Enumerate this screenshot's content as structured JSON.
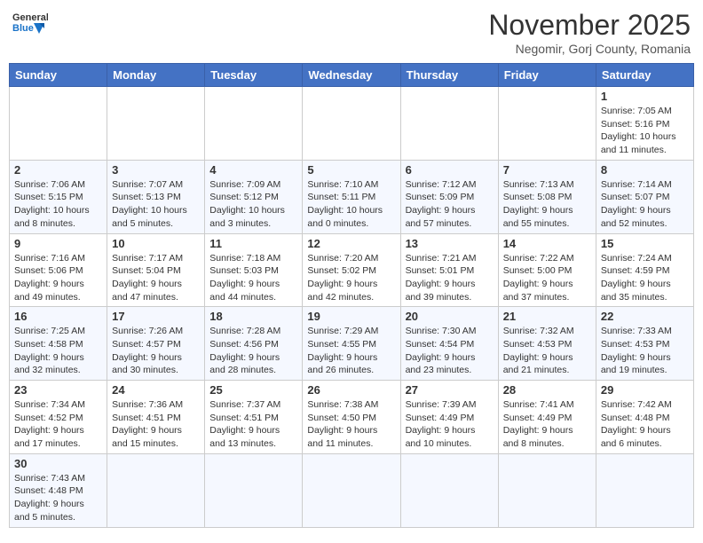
{
  "header": {
    "logo_general": "General",
    "logo_blue": "Blue",
    "month_title": "November 2025",
    "subtitle": "Negomir, Gorj County, Romania"
  },
  "days_of_week": [
    "Sunday",
    "Monday",
    "Tuesday",
    "Wednesday",
    "Thursday",
    "Friday",
    "Saturday"
  ],
  "weeks": [
    [
      {
        "day": "",
        "info": ""
      },
      {
        "day": "",
        "info": ""
      },
      {
        "day": "",
        "info": ""
      },
      {
        "day": "",
        "info": ""
      },
      {
        "day": "",
        "info": ""
      },
      {
        "day": "",
        "info": ""
      },
      {
        "day": "1",
        "info": "Sunrise: 7:05 AM\nSunset: 5:16 PM\nDaylight: 10 hours and 11 minutes."
      }
    ],
    [
      {
        "day": "2",
        "info": "Sunrise: 7:06 AM\nSunset: 5:15 PM\nDaylight: 10 hours and 8 minutes."
      },
      {
        "day": "3",
        "info": "Sunrise: 7:07 AM\nSunset: 5:13 PM\nDaylight: 10 hours and 5 minutes."
      },
      {
        "day": "4",
        "info": "Sunrise: 7:09 AM\nSunset: 5:12 PM\nDaylight: 10 hours and 3 minutes."
      },
      {
        "day": "5",
        "info": "Sunrise: 7:10 AM\nSunset: 5:11 PM\nDaylight: 10 hours and 0 minutes."
      },
      {
        "day": "6",
        "info": "Sunrise: 7:12 AM\nSunset: 5:09 PM\nDaylight: 9 hours and 57 minutes."
      },
      {
        "day": "7",
        "info": "Sunrise: 7:13 AM\nSunset: 5:08 PM\nDaylight: 9 hours and 55 minutes."
      },
      {
        "day": "8",
        "info": "Sunrise: 7:14 AM\nSunset: 5:07 PM\nDaylight: 9 hours and 52 minutes."
      }
    ],
    [
      {
        "day": "9",
        "info": "Sunrise: 7:16 AM\nSunset: 5:06 PM\nDaylight: 9 hours and 49 minutes."
      },
      {
        "day": "10",
        "info": "Sunrise: 7:17 AM\nSunset: 5:04 PM\nDaylight: 9 hours and 47 minutes."
      },
      {
        "day": "11",
        "info": "Sunrise: 7:18 AM\nSunset: 5:03 PM\nDaylight: 9 hours and 44 minutes."
      },
      {
        "day": "12",
        "info": "Sunrise: 7:20 AM\nSunset: 5:02 PM\nDaylight: 9 hours and 42 minutes."
      },
      {
        "day": "13",
        "info": "Sunrise: 7:21 AM\nSunset: 5:01 PM\nDaylight: 9 hours and 39 minutes."
      },
      {
        "day": "14",
        "info": "Sunrise: 7:22 AM\nSunset: 5:00 PM\nDaylight: 9 hours and 37 minutes."
      },
      {
        "day": "15",
        "info": "Sunrise: 7:24 AM\nSunset: 4:59 PM\nDaylight: 9 hours and 35 minutes."
      }
    ],
    [
      {
        "day": "16",
        "info": "Sunrise: 7:25 AM\nSunset: 4:58 PM\nDaylight: 9 hours and 32 minutes."
      },
      {
        "day": "17",
        "info": "Sunrise: 7:26 AM\nSunset: 4:57 PM\nDaylight: 9 hours and 30 minutes."
      },
      {
        "day": "18",
        "info": "Sunrise: 7:28 AM\nSunset: 4:56 PM\nDaylight: 9 hours and 28 minutes."
      },
      {
        "day": "19",
        "info": "Sunrise: 7:29 AM\nSunset: 4:55 PM\nDaylight: 9 hours and 26 minutes."
      },
      {
        "day": "20",
        "info": "Sunrise: 7:30 AM\nSunset: 4:54 PM\nDaylight: 9 hours and 23 minutes."
      },
      {
        "day": "21",
        "info": "Sunrise: 7:32 AM\nSunset: 4:53 PM\nDaylight: 9 hours and 21 minutes."
      },
      {
        "day": "22",
        "info": "Sunrise: 7:33 AM\nSunset: 4:53 PM\nDaylight: 9 hours and 19 minutes."
      }
    ],
    [
      {
        "day": "23",
        "info": "Sunrise: 7:34 AM\nSunset: 4:52 PM\nDaylight: 9 hours and 17 minutes."
      },
      {
        "day": "24",
        "info": "Sunrise: 7:36 AM\nSunset: 4:51 PM\nDaylight: 9 hours and 15 minutes."
      },
      {
        "day": "25",
        "info": "Sunrise: 7:37 AM\nSunset: 4:51 PM\nDaylight: 9 hours and 13 minutes."
      },
      {
        "day": "26",
        "info": "Sunrise: 7:38 AM\nSunset: 4:50 PM\nDaylight: 9 hours and 11 minutes."
      },
      {
        "day": "27",
        "info": "Sunrise: 7:39 AM\nSunset: 4:49 PM\nDaylight: 9 hours and 10 minutes."
      },
      {
        "day": "28",
        "info": "Sunrise: 7:41 AM\nSunset: 4:49 PM\nDaylight: 9 hours and 8 minutes."
      },
      {
        "day": "29",
        "info": "Sunrise: 7:42 AM\nSunset: 4:48 PM\nDaylight: 9 hours and 6 minutes."
      }
    ],
    [
      {
        "day": "30",
        "info": "Sunrise: 7:43 AM\nSunset: 4:48 PM\nDaylight: 9 hours and 5 minutes."
      },
      {
        "day": "",
        "info": ""
      },
      {
        "day": "",
        "info": ""
      },
      {
        "day": "",
        "info": ""
      },
      {
        "day": "",
        "info": ""
      },
      {
        "day": "",
        "info": ""
      },
      {
        "day": "",
        "info": ""
      }
    ]
  ]
}
